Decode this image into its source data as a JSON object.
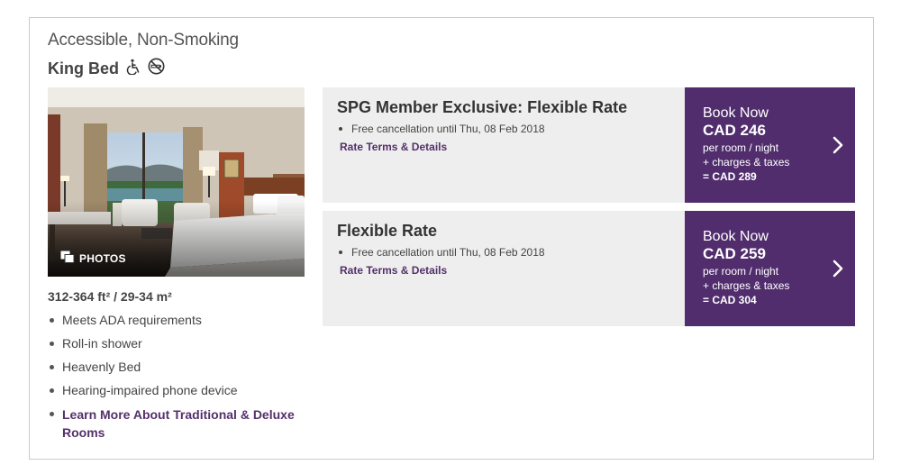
{
  "room": {
    "category": "Accessible, Non-Smoking",
    "bed_type": "King Bed",
    "icons": [
      "wheelchair-icon",
      "no-smoking-icon"
    ],
    "photos_label": "PHOTOS",
    "size": "312-364 ft² / 29-34 m²",
    "amenities": [
      "Meets ADA requirements",
      "Roll-in shower",
      "Heavenly Bed",
      "Hearing-impaired phone device"
    ],
    "learn_more": "Learn More About Traditional & Deluxe Rooms"
  },
  "rates": [
    {
      "name": "SPG Member Exclusive: Flexible Rate",
      "cancellation": "Free cancellation until Thu, 08 Feb 2018",
      "terms_link": "Rate Terms & Details",
      "book_label": "Book Now",
      "price": "CAD 246",
      "per": "per room / night",
      "charges": "+ charges & taxes",
      "total": "= CAD 289"
    },
    {
      "name": "Flexible Rate",
      "cancellation": "Free cancellation until Thu, 08 Feb 2018",
      "terms_link": "Rate Terms & Details",
      "book_label": "Book Now",
      "price": "CAD 259",
      "per": "per room / night",
      "charges": "+ charges & taxes",
      "total": "= CAD 304"
    }
  ],
  "colors": {
    "brand_purple": "#512d6d",
    "link_purple": "#54306a",
    "rate_bg": "#eeeeee",
    "border": "#c9c9c9"
  }
}
